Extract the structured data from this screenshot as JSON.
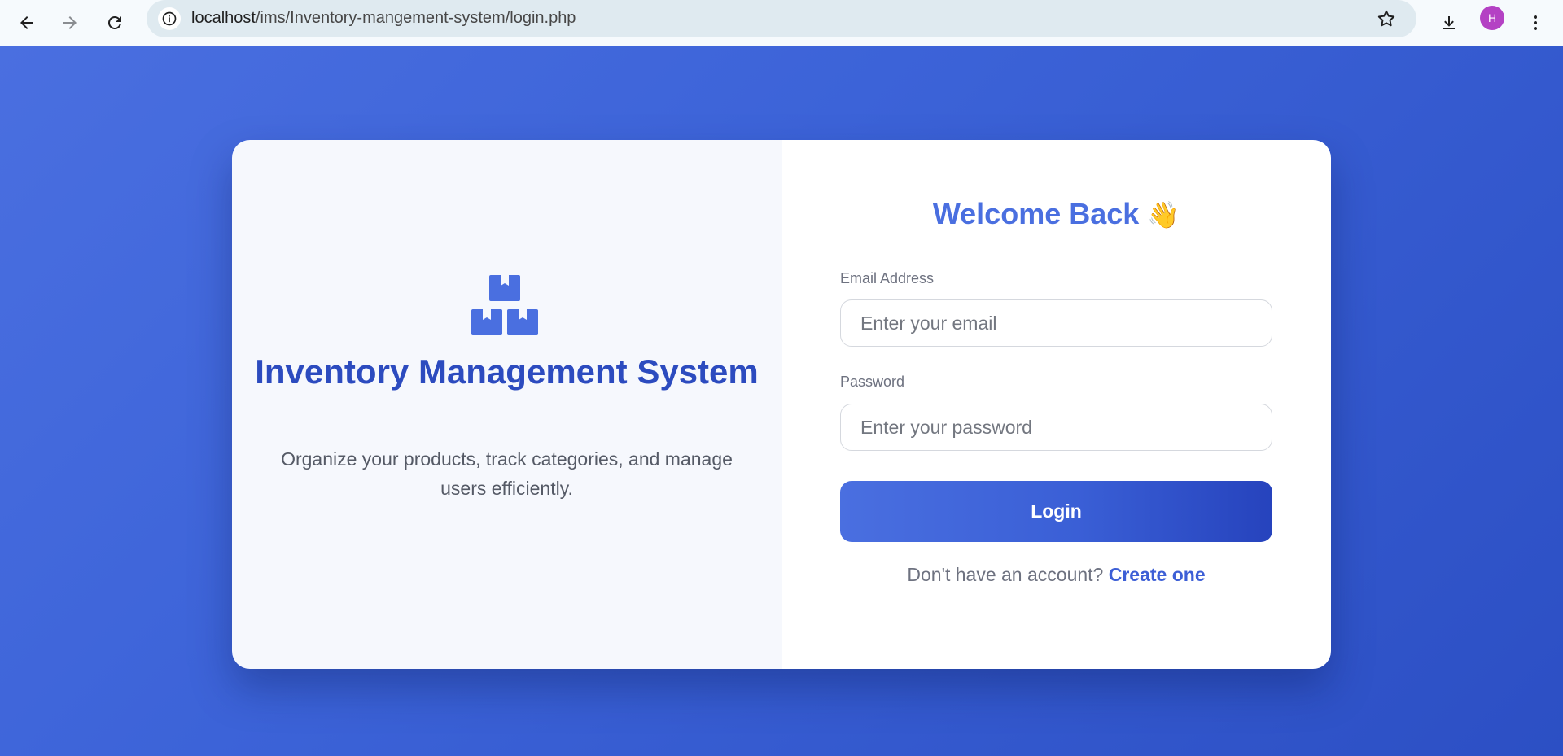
{
  "browser": {
    "url_host": "localhost",
    "url_path": "/ims/Inventory-mangement-system/login.php",
    "avatar_initial": "H",
    "icons": [
      "back-arrow-icon",
      "forward-arrow-icon",
      "reload-icon",
      "site-info-icon",
      "bookmark-star-icon",
      "download-icon",
      "more-vert-icon"
    ]
  },
  "brand": {
    "title": "Inventory Management System",
    "description": "Organize your products, track categories, and manage users efficiently.",
    "icon": "boxes-icon"
  },
  "form": {
    "heading": "Welcome Back",
    "heading_emoji": "👋",
    "email_label": "Email Address",
    "email_placeholder": "Enter your email",
    "email_value": "",
    "password_label": "Password",
    "password_placeholder": "Enter your password",
    "password_value": "",
    "login_label": "Login",
    "signup_prompt": "Don't have an account?",
    "signup_link": "Create one"
  },
  "colors": {
    "accent": "#4a6fe0",
    "accent_dark": "#2643bd",
    "title_blue": "#2c4bbf",
    "avatar": "#b441c4"
  }
}
